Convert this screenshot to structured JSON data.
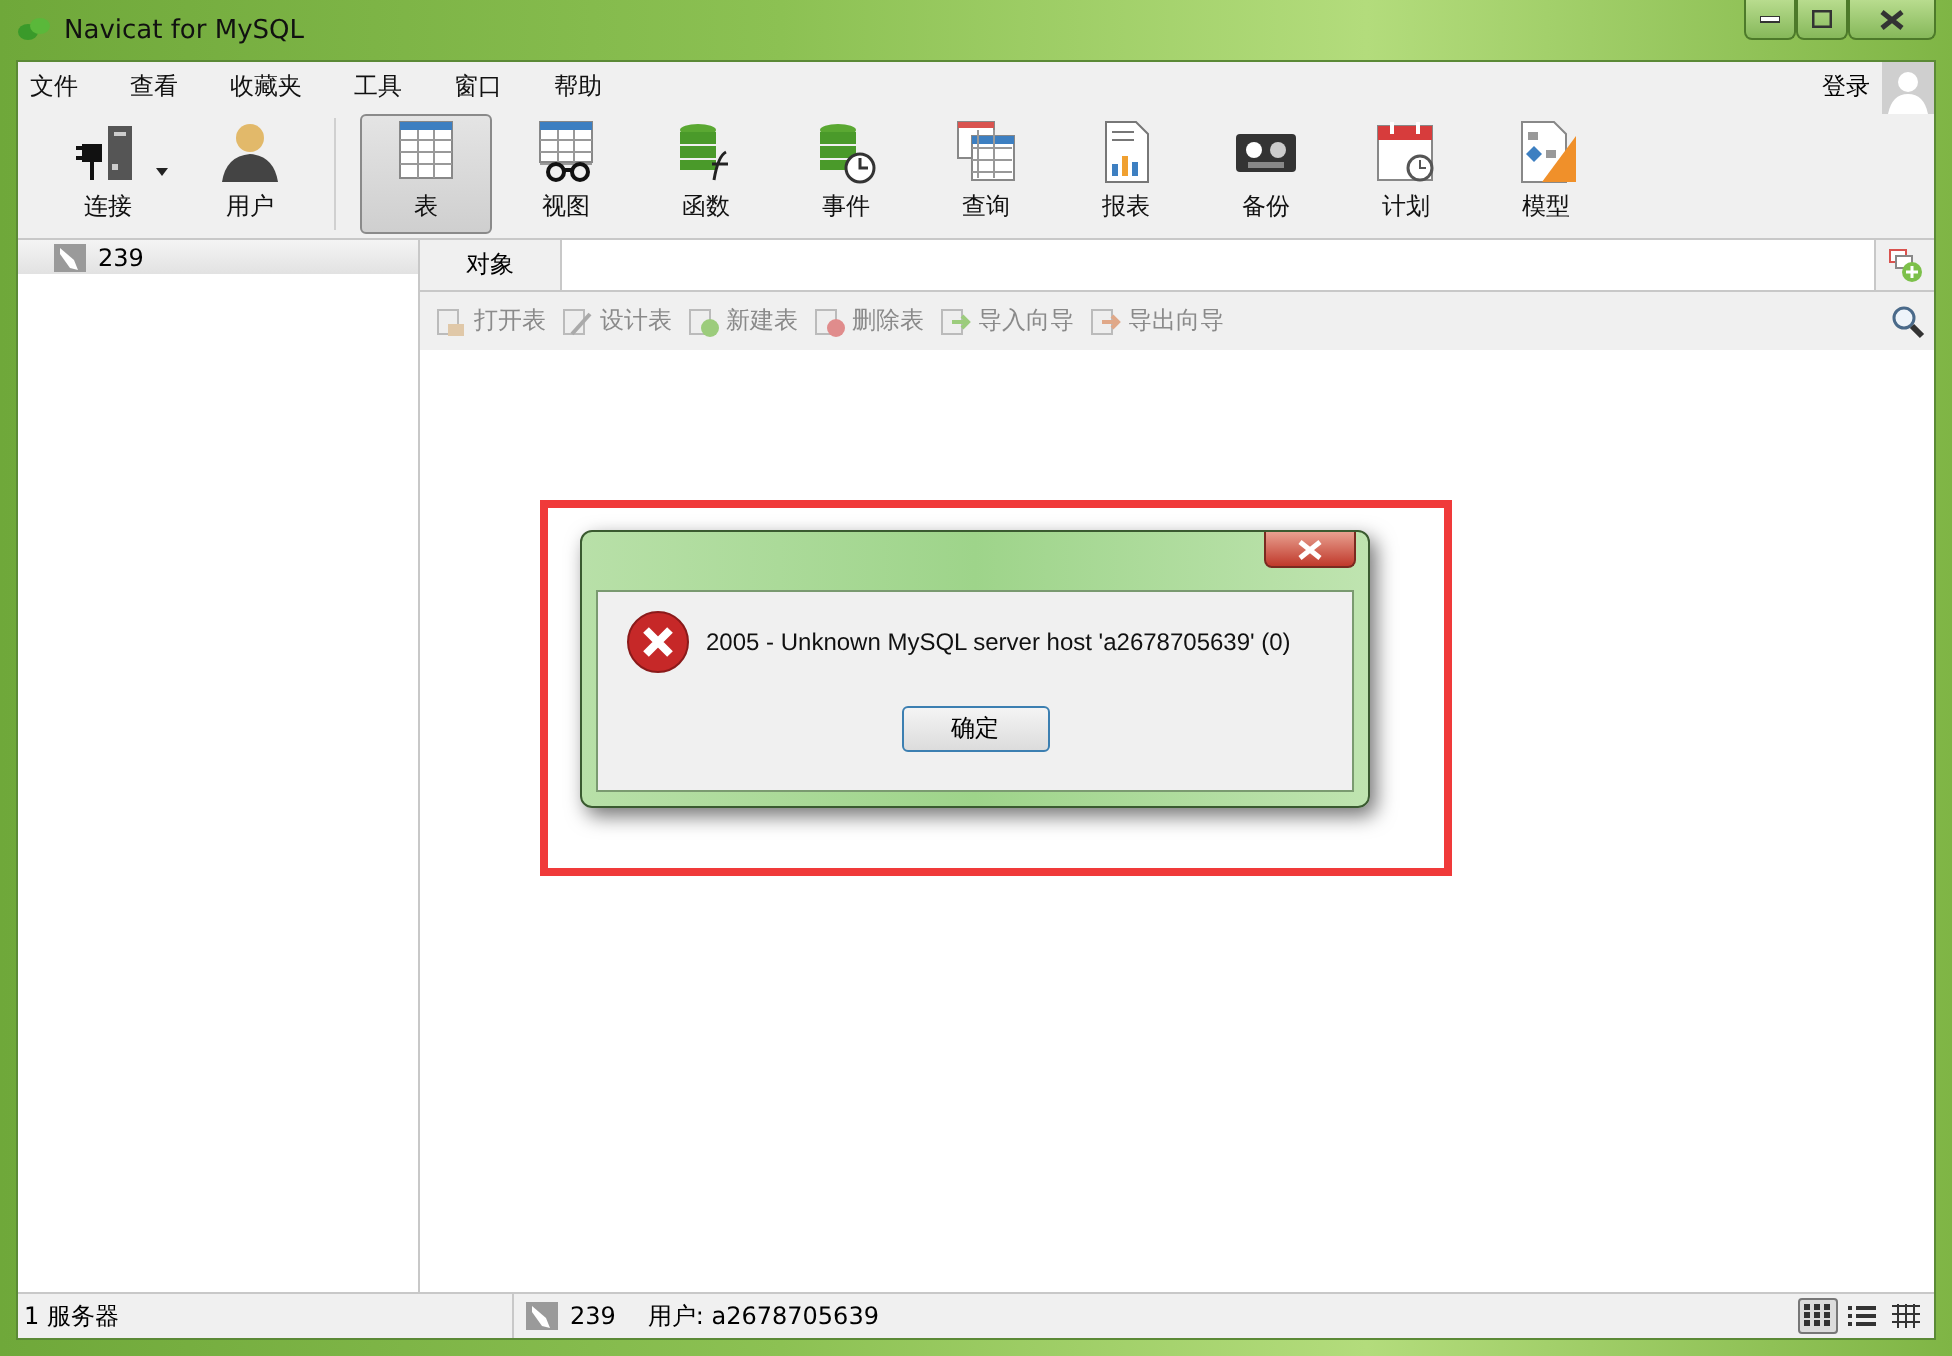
{
  "window": {
    "title": "Navicat for MySQL"
  },
  "menu": [
    "文件",
    "查看",
    "收藏夹",
    "工具",
    "窗口",
    "帮助"
  ],
  "login": "登录",
  "toolbar": [
    {
      "label": "连接",
      "kind": "connection",
      "selected": false
    },
    {
      "label": "用户",
      "kind": "user",
      "selected": false
    },
    {
      "label": "表",
      "kind": "table",
      "selected": true
    },
    {
      "label": "视图",
      "kind": "view",
      "selected": false
    },
    {
      "label": "函数",
      "kind": "function",
      "selected": false
    },
    {
      "label": "事件",
      "kind": "event",
      "selected": false
    },
    {
      "label": "查询",
      "kind": "query",
      "selected": false
    },
    {
      "label": "报表",
      "kind": "report",
      "selected": false
    },
    {
      "label": "备份",
      "kind": "backup",
      "selected": false
    },
    {
      "label": "计划",
      "kind": "schedule",
      "selected": false
    },
    {
      "label": "模型",
      "kind": "model",
      "selected": false
    }
  ],
  "connections": [
    {
      "label": "239"
    }
  ],
  "object_tab": "对象",
  "actions": [
    {
      "label": "打开表",
      "kind": "open",
      "disabled": true
    },
    {
      "label": "设计表",
      "kind": "design",
      "disabled": true
    },
    {
      "label": "新建表",
      "kind": "new",
      "disabled": true
    },
    {
      "label": "删除表",
      "kind": "delete",
      "disabled": true
    },
    {
      "label": "导入向导",
      "kind": "import",
      "disabled": true
    },
    {
      "label": "导出向导",
      "kind": "export",
      "disabled": true
    }
  ],
  "dialog": {
    "message": "2005 - Unknown MySQL server host 'a2678705639' (0)",
    "button": "确定"
  },
  "status_bar": {
    "count": "1 服务器",
    "connection": "239",
    "user": "用户: a2678705639",
    "views": [
      {
        "kind": "grid",
        "selected": true
      },
      {
        "kind": "list",
        "selected": false
      },
      {
        "kind": "detail",
        "selected": false
      }
    ]
  }
}
